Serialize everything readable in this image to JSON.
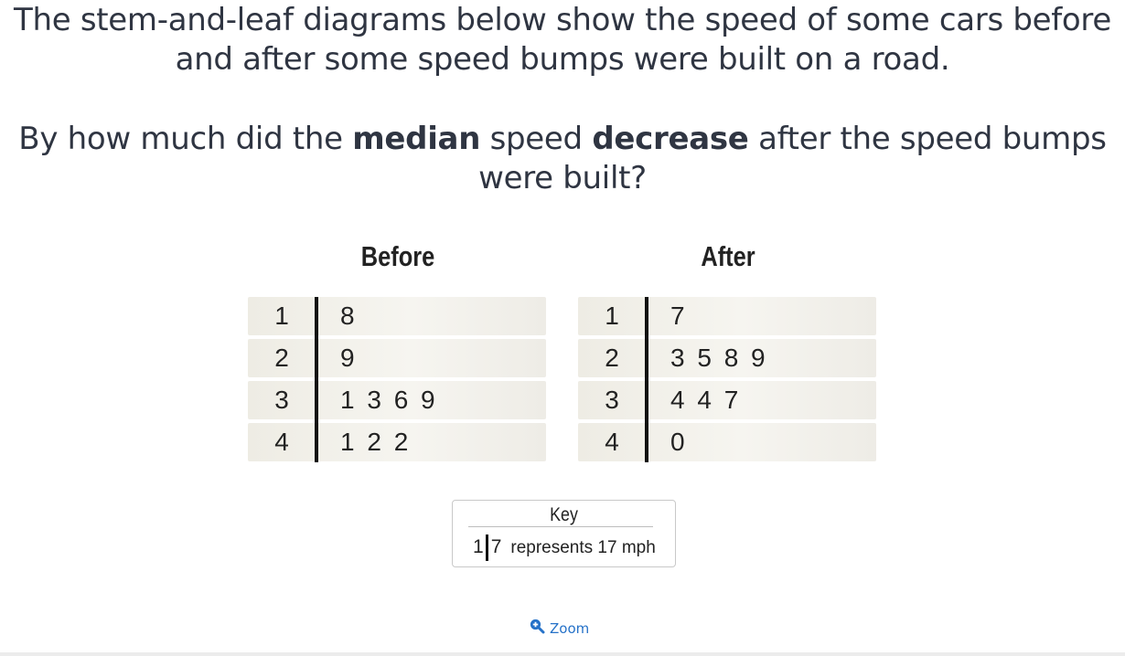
{
  "question": {
    "line1": "The stem-and-leaf diagrams below show the speed of some cars before and after some speed bumps were built on a road.",
    "line2_part1": "By how much did the ",
    "line2_bold1": "median",
    "line2_part2": " speed ",
    "line2_bold2": "decrease",
    "line2_part3": " after the speed bumps were built?"
  },
  "chart_data": [
    {
      "type": "table",
      "title": "Before",
      "rows": [
        {
          "stem": "1",
          "leaves": "8"
        },
        {
          "stem": "2",
          "leaves": "9"
        },
        {
          "stem": "3",
          "leaves": "1 3 6 9"
        },
        {
          "stem": "4",
          "leaves": "1 2 2"
        }
      ]
    },
    {
      "type": "table",
      "title": "After",
      "rows": [
        {
          "stem": "1",
          "leaves": "7"
        },
        {
          "stem": "2",
          "leaves": "3 5 8 9"
        },
        {
          "stem": "3",
          "leaves": "4 4 7"
        },
        {
          "stem": "4",
          "leaves": "0"
        }
      ]
    }
  ],
  "key": {
    "title": "Key",
    "stem": "1",
    "leaf": "7",
    "text": "represents 17 mph"
  },
  "zoom": {
    "label": "Zoom",
    "icon": "zoom-in-icon",
    "color": "#2672c8"
  }
}
